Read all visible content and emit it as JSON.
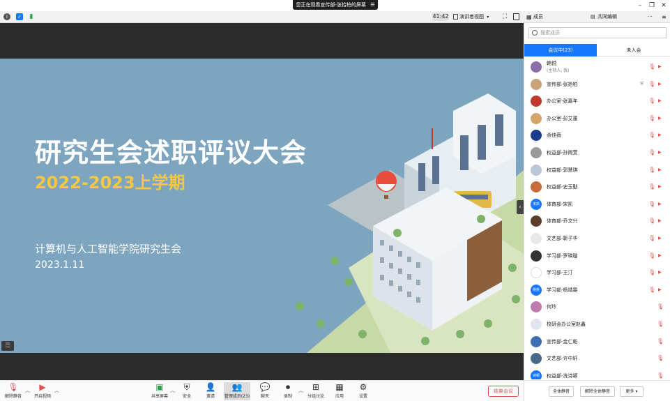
{
  "titlebar": {
    "share_banner": "您正在观看宣传部-张拾柏的屏幕",
    "menu_icon": "menu-icon",
    "window_controls": [
      "minimize-icon",
      "restore-icon",
      "close-icon"
    ]
  },
  "topbar": {
    "timer": "41:42",
    "view_mode": "演讲者视图",
    "icons": [
      "info-icon",
      "shield-icon",
      "signal-icon",
      "fullscreen-icon",
      "window-icon"
    ]
  },
  "panel_header": {
    "members_title": "成员",
    "meeting_panel_title": "共同编辑",
    "more": "···"
  },
  "slide": {
    "title": "研究生会述职评议大会",
    "term": "2022-2023上学期",
    "organization": "计算机与人工智能学院研究生会",
    "date": "2023.1.11",
    "colors": {
      "background": "#7da5c0",
      "term": "#f6c842",
      "text": "#ffffff"
    }
  },
  "bottombar": {
    "items": [
      {
        "label": "解除静音",
        "icon": "mic-muted-icon"
      },
      {
        "label": "开启视频",
        "icon": "camera-off-icon"
      },
      {
        "label": "共享屏幕",
        "icon": "share-screen-icon"
      },
      {
        "label": "安全",
        "icon": "security-icon"
      },
      {
        "label": "邀请",
        "icon": "invite-icon"
      },
      {
        "label": "管理成员(23)",
        "icon": "members-icon"
      },
      {
        "label": "聊天",
        "icon": "chat-icon"
      },
      {
        "label": "录制",
        "icon": "record-icon"
      },
      {
        "label": "分组讨论",
        "icon": "breakout-icon"
      },
      {
        "label": "应用",
        "icon": "apps-icon"
      },
      {
        "label": "设置",
        "icon": "settings-icon"
      }
    ],
    "end_meeting": "结束会议"
  },
  "panel": {
    "search_placeholder": "搜索成员",
    "tabs": [
      {
        "label": "会议中(23)",
        "active": true
      },
      {
        "label": "未入会",
        "active": false
      }
    ],
    "participants": [
      {
        "name": "韩悦",
        "sub": "(主持人, 我)",
        "avatar_color": "#8a6fa8",
        "avatar_text": "",
        "mic_muted": true,
        "cam_off": true,
        "shield": false
      },
      {
        "name": "宣传部-张拾柏",
        "sub": "",
        "avatar_color": "#c9a27a",
        "avatar_text": "",
        "mic_muted": true,
        "cam_off": true,
        "shield": true
      },
      {
        "name": "办公室-张嘉年",
        "sub": "",
        "avatar_color": "#c0392b",
        "avatar_text": "",
        "mic_muted": true,
        "cam_off": true,
        "shield": false
      },
      {
        "name": "办公室-彭艾蓬",
        "sub": "",
        "avatar_color": "#d4a56a",
        "avatar_text": "",
        "mic_muted": true,
        "cam_off": true,
        "shield": false
      },
      {
        "name": "余佳薇",
        "sub": "",
        "avatar_color": "#1a3c8c",
        "avatar_text": "",
        "mic_muted": true,
        "cam_off": true,
        "shield": false
      },
      {
        "name": "权益部-孙雨萱",
        "sub": "",
        "avatar_color": "#9a9a9a",
        "avatar_text": "",
        "mic_muted": true,
        "cam_off": true,
        "shield": false
      },
      {
        "name": "权益部-郭慧琪",
        "sub": "",
        "avatar_color": "#b9c7d6",
        "avatar_text": "",
        "mic_muted": true,
        "cam_off": true,
        "shield": false
      },
      {
        "name": "权益部-史玉勤",
        "sub": "",
        "avatar_color": "#c96b3b",
        "avatar_text": "",
        "mic_muted": true,
        "cam_off": true,
        "shield": false
      },
      {
        "name": "体育部-宋凯",
        "sub": "",
        "avatar_color": "#1677ff",
        "avatar_text": "宋凯",
        "mic_muted": true,
        "cam_off": true,
        "shield": false
      },
      {
        "name": "体育部-乔文兴",
        "sub": "",
        "avatar_color": "#5a3e2b",
        "avatar_text": "",
        "mic_muted": true,
        "cam_off": true,
        "shield": false
      },
      {
        "name": "文艺部-靳子华",
        "sub": "",
        "avatar_color": "#e8e8e8",
        "avatar_text": "",
        "mic_muted": true,
        "cam_off": true,
        "shield": false
      },
      {
        "name": "学习部-罗瑛璇",
        "sub": "",
        "avatar_color": "#333333",
        "avatar_text": "",
        "mic_muted": true,
        "cam_off": true,
        "shield": false
      },
      {
        "name": "学习部-王汀",
        "sub": "",
        "avatar_color": "#ffffff",
        "avatar_text": "",
        "mic_muted": true,
        "cam_off": true,
        "shield": false
      },
      {
        "name": "学习部-杨靖雯",
        "sub": "",
        "avatar_color": "#1677ff",
        "avatar_text": "杨雯",
        "mic_muted": true,
        "cam_off": true,
        "shield": false
      },
      {
        "name": "何玲",
        "sub": "",
        "avatar_color": "#c17bb0",
        "avatar_text": "",
        "mic_muted": true,
        "cam_off": false,
        "shield": false
      },
      {
        "name": "校研会办公室赵鑫",
        "sub": "",
        "avatar_color": "#dfe6ee",
        "avatar_text": "",
        "mic_muted": true,
        "cam_off": false,
        "shield": false
      },
      {
        "name": "宣传部-金仁乾",
        "sub": "",
        "avatar_color": "#3e6fb5",
        "avatar_text": "",
        "mic_muted": true,
        "cam_off": false,
        "shield": false
      },
      {
        "name": "文艺部-许中轩",
        "sub": "",
        "avatar_color": "#4a6a8a",
        "avatar_text": "",
        "mic_muted": true,
        "cam_off": false,
        "shield": false
      },
      {
        "name": "权益部-冼诗颖",
        "sub": "",
        "avatar_color": "#1677ff",
        "avatar_text": "诗颖",
        "mic_muted": true,
        "cam_off": false,
        "shield": false
      }
    ],
    "footer": {
      "mute_all": "全体静音",
      "unmute_all": "解除全体静音",
      "more": "更多"
    }
  }
}
